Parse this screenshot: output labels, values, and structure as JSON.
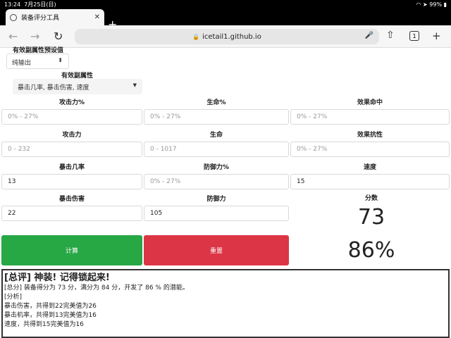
{
  "status": {
    "time": "13:24",
    "date": "7月25日(日)",
    "battery": "99%"
  },
  "browser": {
    "tab_title": "装备评分工具",
    "url": "icetail1.github.io",
    "tab_count": "1"
  },
  "form": {
    "preset_label_cut": "有效副属性预设值",
    "preset_value": "纯输出",
    "effective_label": "有效副属性",
    "effective_value": "暴击几率, 暴击伤害, 速度",
    "fields": [
      {
        "label": "攻击力%",
        "placeholder": "0% - 27%",
        "value": ""
      },
      {
        "label": "生命%",
        "placeholder": "0% - 27%",
        "value": ""
      },
      {
        "label": "效果命中",
        "placeholder": "0% - 27%",
        "value": ""
      },
      {
        "label": "攻击力",
        "placeholder": "0 - 232",
        "value": ""
      },
      {
        "label": "生命",
        "placeholder": "0 - 1017",
        "value": ""
      },
      {
        "label": "效果抗性",
        "placeholder": "0% - 27%",
        "value": ""
      },
      {
        "label": "暴击几率",
        "placeholder": "",
        "value": "13"
      },
      {
        "label": "防御力%",
        "placeholder": "0% - 27%",
        "value": ""
      },
      {
        "label": "速度",
        "placeholder": "",
        "value": "15"
      },
      {
        "label": "暴击伤害",
        "placeholder": "",
        "value": "22"
      },
      {
        "label": "防御力",
        "placeholder": "",
        "value": "105"
      }
    ]
  },
  "score": {
    "label": "分数",
    "value": "73",
    "percent": "86%"
  },
  "buttons": {
    "calc": "计算",
    "reset": "重置"
  },
  "result": {
    "summary": "[总评] 神装! 记得锁起来!",
    "total": "[总分] 装备得分为 73 分，满分为 84 分，开发了 86 % 的潜能。",
    "analysis_title": "[分析]",
    "lines": [
      "暴击伤害，共得到22完美值为26",
      "暴击机率，共得到13完美值为16",
      "速度，共得到15完美值为16"
    ]
  }
}
